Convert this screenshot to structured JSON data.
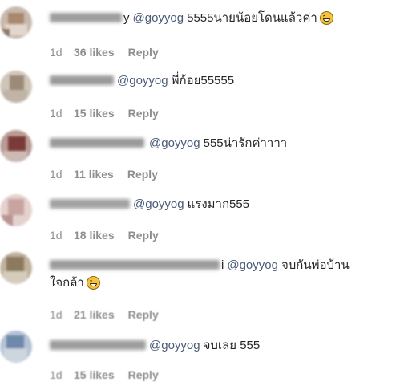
{
  "comments": [
    {
      "username_visible": "y",
      "mention": "@goyyog",
      "text": "5555นายน้อยโดนแล้วค่า",
      "emoji": "grinning-squinting-face",
      "age": "1d",
      "likes": "36 likes",
      "reply": "Reply"
    },
    {
      "username_visible": "",
      "mention": "@goyyog",
      "text": "พี่ก้อย55555",
      "age": "1d",
      "likes": "15 likes",
      "reply": "Reply"
    },
    {
      "username_visible": "",
      "mention": "@goyyog",
      "text": "555น่ารักค่าาาา",
      "age": "1d",
      "likes": "11 likes",
      "reply": "Reply"
    },
    {
      "username_visible": "",
      "mention": "@goyyog",
      "text": "แรงมาก555",
      "age": "1d",
      "likes": "18 likes",
      "reply": "Reply"
    },
    {
      "username_visible": "i",
      "mention": "@goyyog",
      "text": "จบกันพ่อบ้าน",
      "text_line2": "ใจกล้า",
      "emoji": "grinning-squinting-face",
      "age": "1d",
      "likes": "21 likes",
      "reply": "Reply"
    },
    {
      "username_visible": "",
      "mention": "@goyyog",
      "text": "จบเลย 555",
      "age": "1d",
      "likes": "15 likes",
      "reply": "Reply"
    }
  ]
}
